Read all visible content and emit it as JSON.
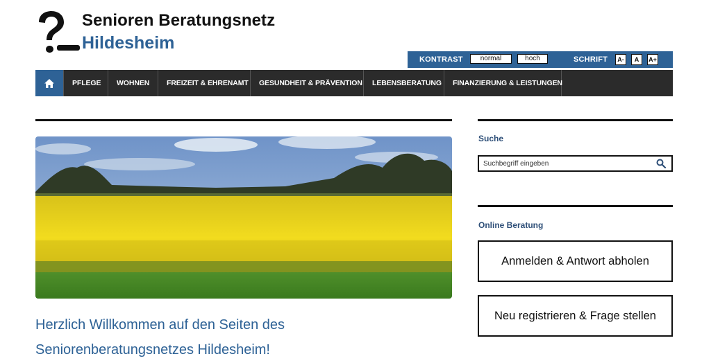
{
  "header": {
    "title": "Senioren Beratungsnetz",
    "subtitle": "Hildesheim"
  },
  "accessibility": {
    "contrast_label": "KONTRAST",
    "contrast_options": [
      "normal",
      "hoch"
    ],
    "font_label": "SCHRIFT",
    "font_options": [
      "A-",
      "A",
      "A+"
    ]
  },
  "nav": {
    "home_icon": "home-icon",
    "items": [
      "PFLEGE",
      "WOHNEN",
      "FREIZEIT & EHRENAMT",
      "GESUNDHEIT & PRÄVENTION",
      "LEBENSBERATUNG",
      "FINANZIERUNG & LEISTUNGEN"
    ]
  },
  "main": {
    "welcome_line1": "Herzlich Willkommen auf den Seiten des",
    "welcome_line2": "Seniorenberatungsnetzes Hildesheim!"
  },
  "sidebar": {
    "search_heading": "Suche",
    "search_placeholder": "Suchbegriff eingeben",
    "online_heading": "Online Beratung",
    "login_button": "Anmelden & Antwort abholen",
    "register_button": "Neu registrieren & Frage stellen"
  },
  "colors": {
    "brand_blue": "#2e6296",
    "nav_dark": "#2b2b2b"
  }
}
